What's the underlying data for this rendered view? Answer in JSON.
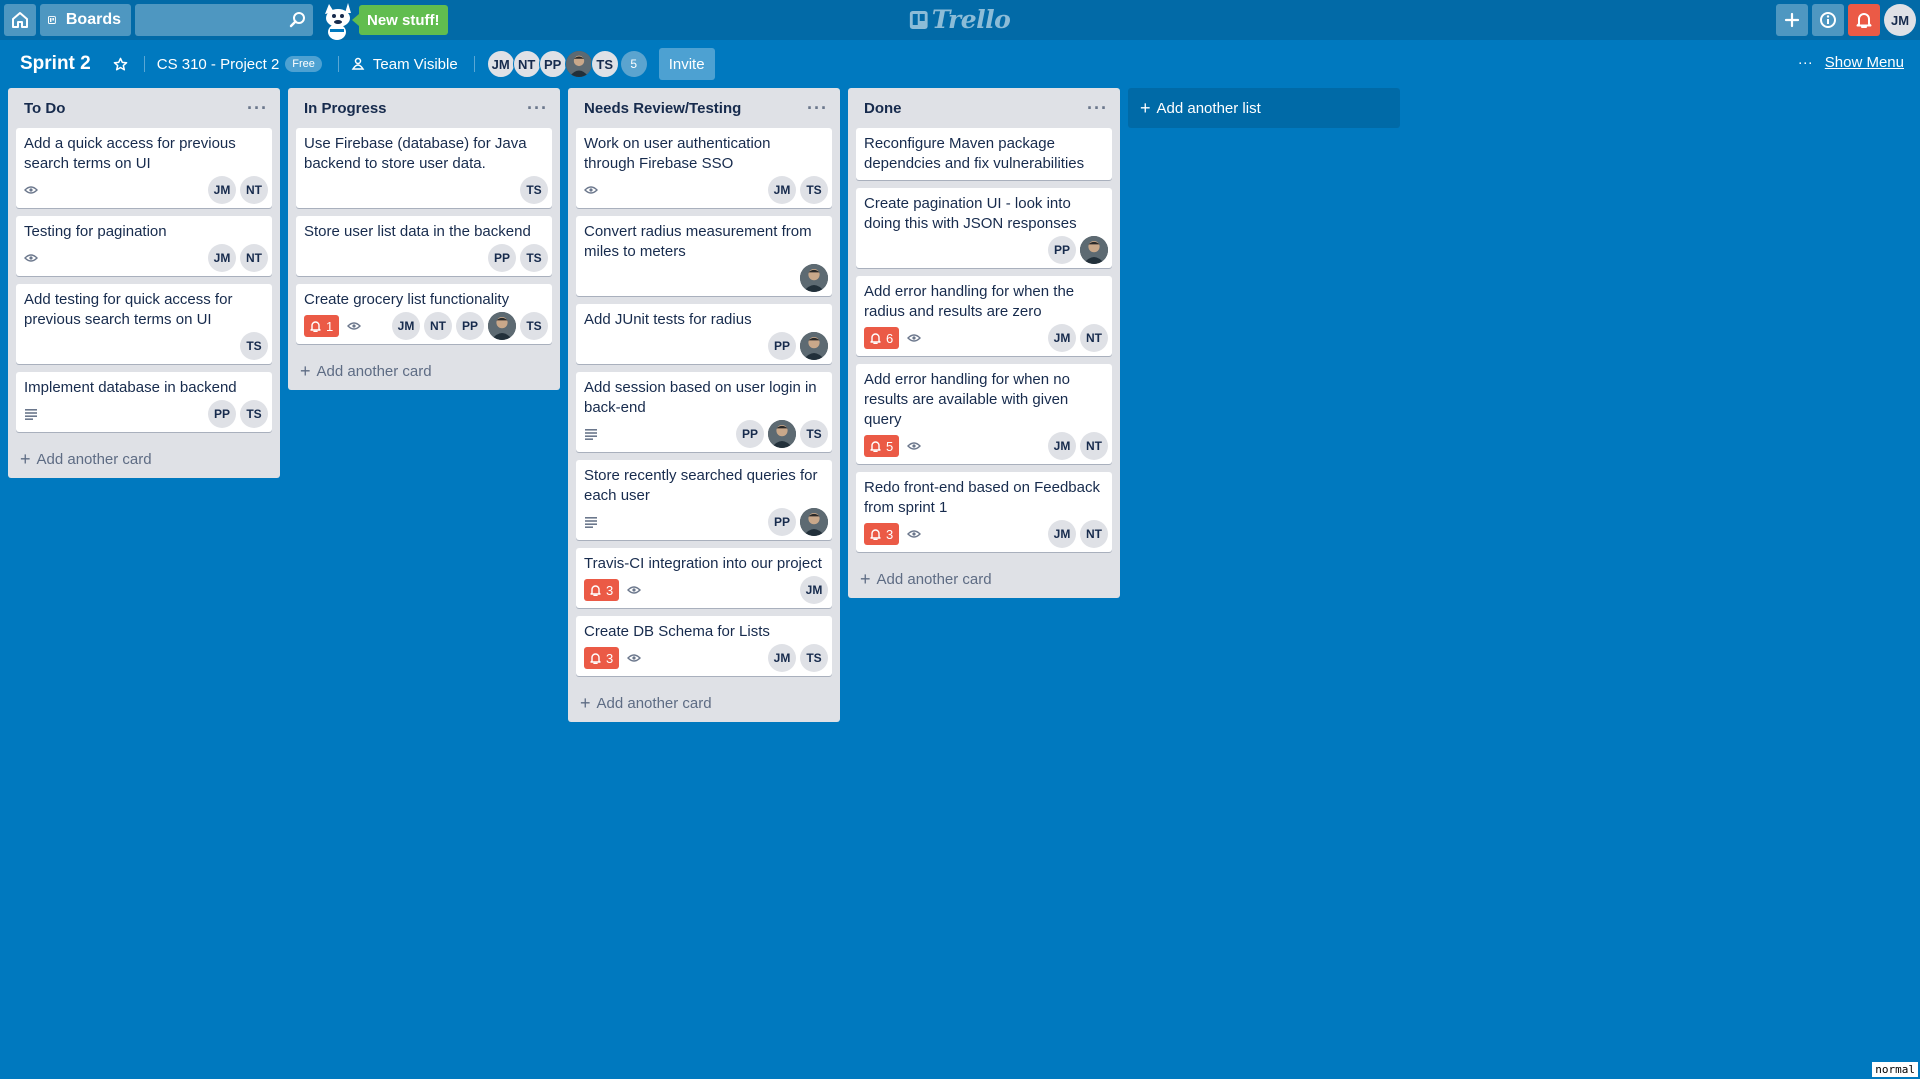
{
  "header": {
    "boards_label": "Boards",
    "search_value": "",
    "new_stuff_label": "New stuff!",
    "logo_text": "Trello",
    "user_initials": "JM"
  },
  "board": {
    "title": "Sprint 2",
    "team_name": "CS 310 - Project 2",
    "plan_badge": "Free",
    "visibility": "Team Visible",
    "members": [
      "JM",
      "NT",
      "PP",
      "photo",
      "TS"
    ],
    "extra_members": "5",
    "invite_label": "Invite",
    "show_menu_label": "Show Menu"
  },
  "lists": [
    {
      "title": "To Do",
      "add_card": "Add another card",
      "cards": [
        {
          "title": "Add a quick access for previous search terms on UI",
          "watch": true,
          "description": false,
          "alert": null,
          "members": [
            "JM",
            "NT"
          ]
        },
        {
          "title": "Testing for pagination",
          "watch": true,
          "description": false,
          "alert": null,
          "members": [
            "JM",
            "NT"
          ]
        },
        {
          "title": "Add testing for quick access for previous search terms on UI",
          "watch": false,
          "description": false,
          "alert": null,
          "members": [
            "TS"
          ]
        },
        {
          "title": "Implement database in backend",
          "watch": false,
          "description": true,
          "alert": null,
          "members": [
            "PP",
            "TS"
          ]
        }
      ]
    },
    {
      "title": "In Progress",
      "add_card": "Add another card",
      "cards": [
        {
          "title": "Use Firebase (database) for Java backend to store user data.",
          "watch": false,
          "description": false,
          "alert": null,
          "members": [
            "TS"
          ]
        },
        {
          "title": "Store user list data in the backend",
          "watch": false,
          "description": false,
          "alert": null,
          "members": [
            "PP",
            "TS"
          ]
        },
        {
          "title": "Create grocery list functionality",
          "watch": true,
          "description": false,
          "alert": "1",
          "members": [
            "JM",
            "NT",
            "PP",
            "photo",
            "TS"
          ]
        }
      ]
    },
    {
      "title": "Needs Review/Testing",
      "add_card": "Add another card",
      "cards": [
        {
          "title": "Work on user authentication through Firebase SSO",
          "watch": true,
          "description": false,
          "alert": null,
          "members": [
            "JM",
            "TS"
          ]
        },
        {
          "title": "Convert radius measurement from miles to meters",
          "watch": false,
          "description": false,
          "alert": null,
          "members": [
            "photo"
          ]
        },
        {
          "title": "Add JUnit tests for radius",
          "watch": false,
          "description": false,
          "alert": null,
          "members": [
            "PP",
            "photo"
          ]
        },
        {
          "title": "Add session based on user login in back-end",
          "watch": false,
          "description": true,
          "alert": null,
          "members": [
            "PP",
            "photo",
            "TS"
          ]
        },
        {
          "title": "Store recently searched queries for each user",
          "watch": false,
          "description": true,
          "alert": null,
          "members": [
            "PP",
            "photo"
          ]
        },
        {
          "title": "Travis-CI integration into our project",
          "watch": true,
          "description": false,
          "alert": "3",
          "members": [
            "JM"
          ]
        },
        {
          "title": "Create DB Schema for Lists",
          "watch": true,
          "description": false,
          "alert": "3",
          "members": [
            "JM",
            "TS"
          ]
        }
      ]
    },
    {
      "title": "Done",
      "add_card": "Add another card",
      "cards": [
        {
          "title": "Reconfigure Maven package dependcies and fix vulnerabilities",
          "watch": false,
          "description": false,
          "alert": null,
          "members": []
        },
        {
          "title": "Create pagination UI - look into doing this with JSON responses",
          "watch": false,
          "description": false,
          "alert": null,
          "members": [
            "PP",
            "photo"
          ]
        },
        {
          "title": "Add error handling for when the radius and results are zero",
          "watch": true,
          "description": false,
          "alert": "6",
          "members": [
            "JM",
            "NT"
          ]
        },
        {
          "title": "Add error handling for when no results are available with given query",
          "watch": true,
          "description": false,
          "alert": "5",
          "members": [
            "JM",
            "NT"
          ]
        },
        {
          "title": "Redo front-end based on Feedback from sprint 1",
          "watch": true,
          "description": false,
          "alert": "3",
          "members": [
            "JM",
            "NT"
          ]
        }
      ]
    }
  ],
  "add_list_label": "Add another list",
  "mode_indicator": "normal",
  "colors": {
    "board_bg": "#0079bf",
    "header_bg": "#026aa7",
    "alert": "#eb5a46",
    "new_stuff": "#61bd4f"
  }
}
